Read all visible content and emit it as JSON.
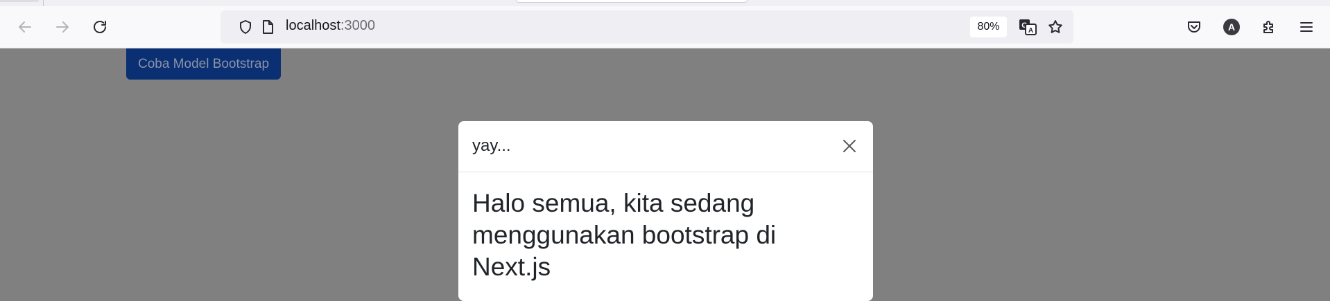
{
  "browser": {
    "url_host": "localhost",
    "url_port": ":3000",
    "zoom": "80%",
    "account_initial": "A"
  },
  "icons": {
    "back": "arrow-left-icon",
    "forward": "arrow-right-icon",
    "reload": "reload-icon",
    "shield": "shield-icon",
    "page": "page-icon",
    "translate": "translate-icon",
    "bookmark": "star-icon",
    "pocket": "pocket-icon",
    "account": "account-avatar",
    "extensions": "puzzle-icon",
    "menu": "hamburger-menu-icon",
    "close": "close-icon"
  },
  "page": {
    "button_label": "Coba Model Bootstrap"
  },
  "modal": {
    "title": "yay...",
    "body": "Halo semua, kita sedang menggunakan bootstrap di Next.js"
  },
  "colors": {
    "backdrop": "#808080",
    "primary_button": "#0a2f73",
    "modal_bg": "#ffffff"
  }
}
